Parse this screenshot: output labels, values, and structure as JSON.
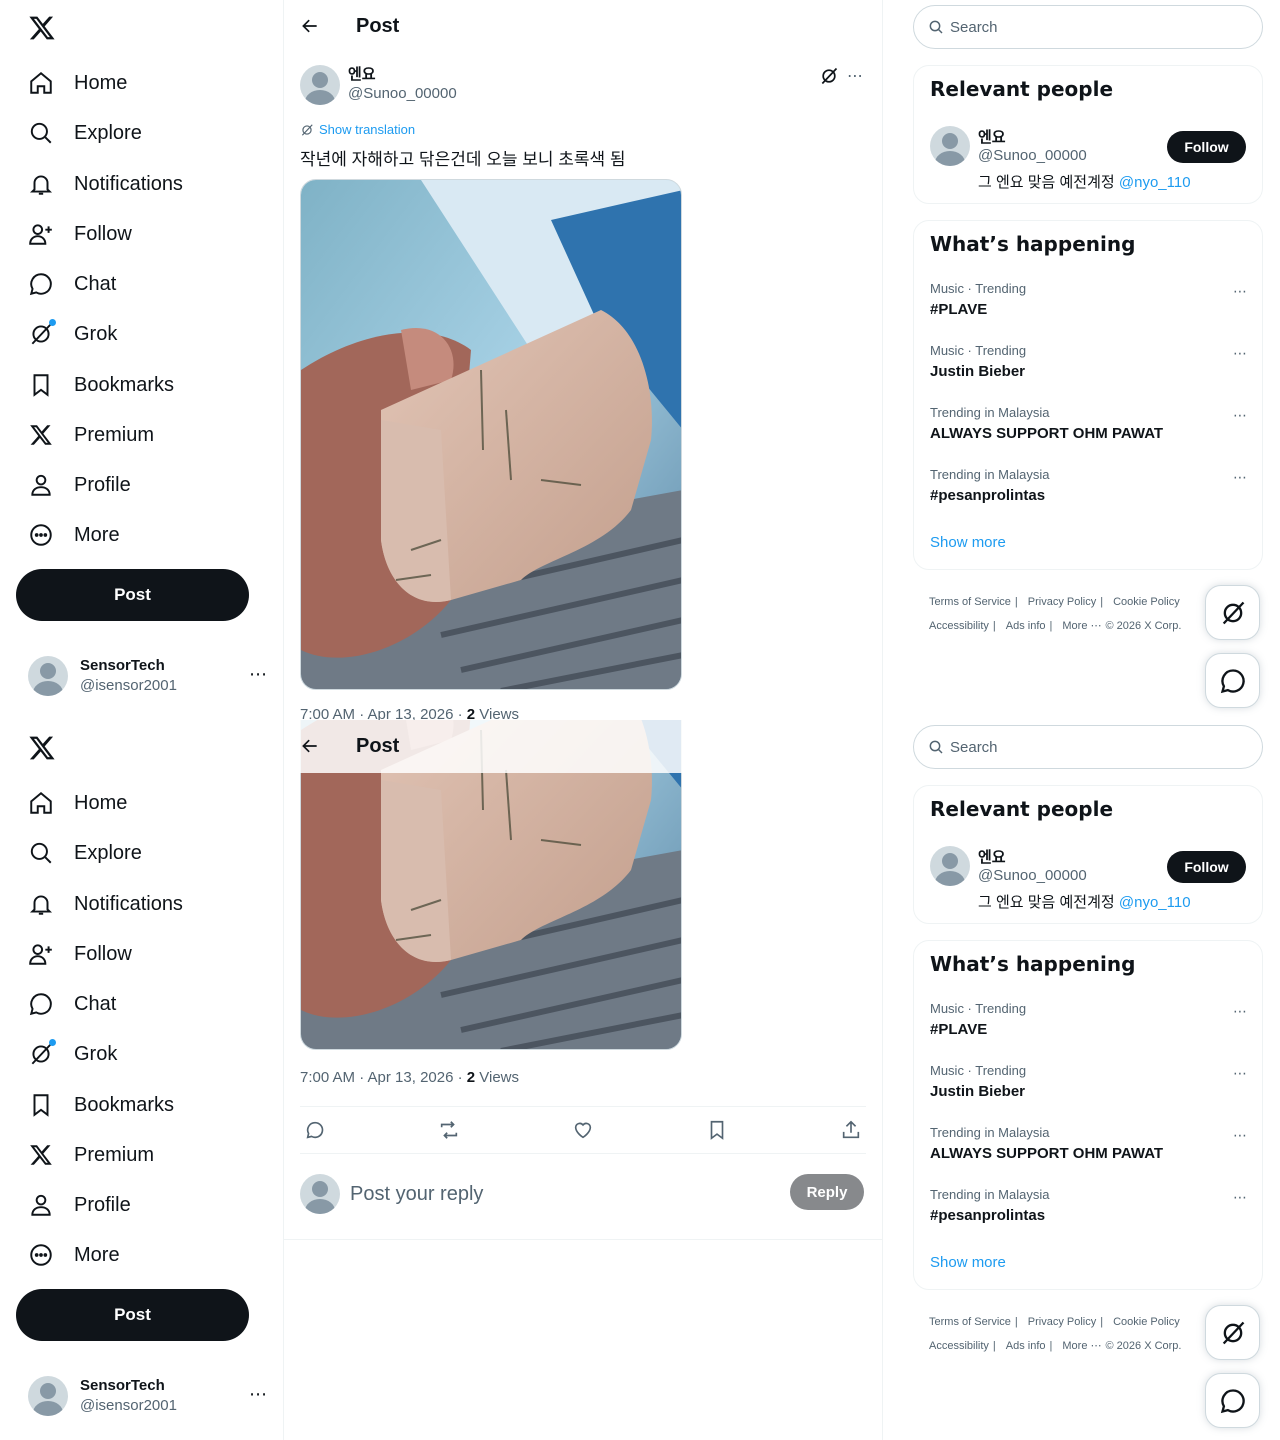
{
  "nav": {
    "items": [
      {
        "label": "Home",
        "icon": "home-icon"
      },
      {
        "label": "Explore",
        "icon": "search-icon"
      },
      {
        "label": "Notifications",
        "icon": "bell-icon"
      },
      {
        "label": "Follow",
        "icon": "person-plus-icon"
      },
      {
        "label": "Chat",
        "icon": "chat-bubble-icon"
      },
      {
        "label": "Grok",
        "icon": "grok-icon"
      },
      {
        "label": "Bookmarks",
        "icon": "bookmark-icon"
      },
      {
        "label": "Premium",
        "icon": "x-logo-icon"
      },
      {
        "label": "Profile",
        "icon": "person-icon"
      },
      {
        "label": "More",
        "icon": "more-circle-icon"
      }
    ],
    "post_label": "Post",
    "account": {
      "name": "SensorTech",
      "handle": "@isensor2001",
      "more": "⋯"
    }
  },
  "header": {
    "title": "Post"
  },
  "post": {
    "author_name": "엔요",
    "author_handle": "@Sunoo_00000",
    "more": "⋯",
    "show_translation": "Show translation",
    "text": "작년에 자해하고 닦은건데 오늘 보니 초록색 됨",
    "time": "7:00 AM · Apr 13, 2026 · ",
    "views_count": "2",
    "views_label": " Views"
  },
  "reply": {
    "placeholder": "Post your reply",
    "button": "Reply"
  },
  "search": {
    "placeholder": "Search"
  },
  "relevant_people": {
    "title": "Relevant people",
    "person": {
      "name": "엔요",
      "handle": "@Sunoo_00000",
      "bio": "그 엔요 맞음 예전계정 ",
      "mention": "@nyo_110",
      "follow_label": "Follow"
    }
  },
  "trends": {
    "title": "What’s happening",
    "items": [
      {
        "context": "Music · Trending",
        "name": "#PLAVE"
      },
      {
        "context": "Music · Trending",
        "name": "Justin Bieber"
      },
      {
        "context": "Trending in Malaysia",
        "name": "ALWAYS SUPPORT OHM PAWAT"
      },
      {
        "context": "Trending in Malaysia",
        "name": "#pesanprolintas"
      }
    ],
    "more_icon": "⋯",
    "show_more": "Show more"
  },
  "footer": {
    "links": [
      "Terms of Service",
      "Privacy Policy",
      "Cookie Policy",
      "Accessibility",
      "Ads info",
      "More ⋯",
      "© 2026 X Corp."
    ]
  },
  "colors": {
    "accent": "#1d9bf0",
    "text": "#0f1419",
    "secondary": "#536471",
    "button_dark": "#0f1419",
    "reply_disabled": "#87898c"
  }
}
